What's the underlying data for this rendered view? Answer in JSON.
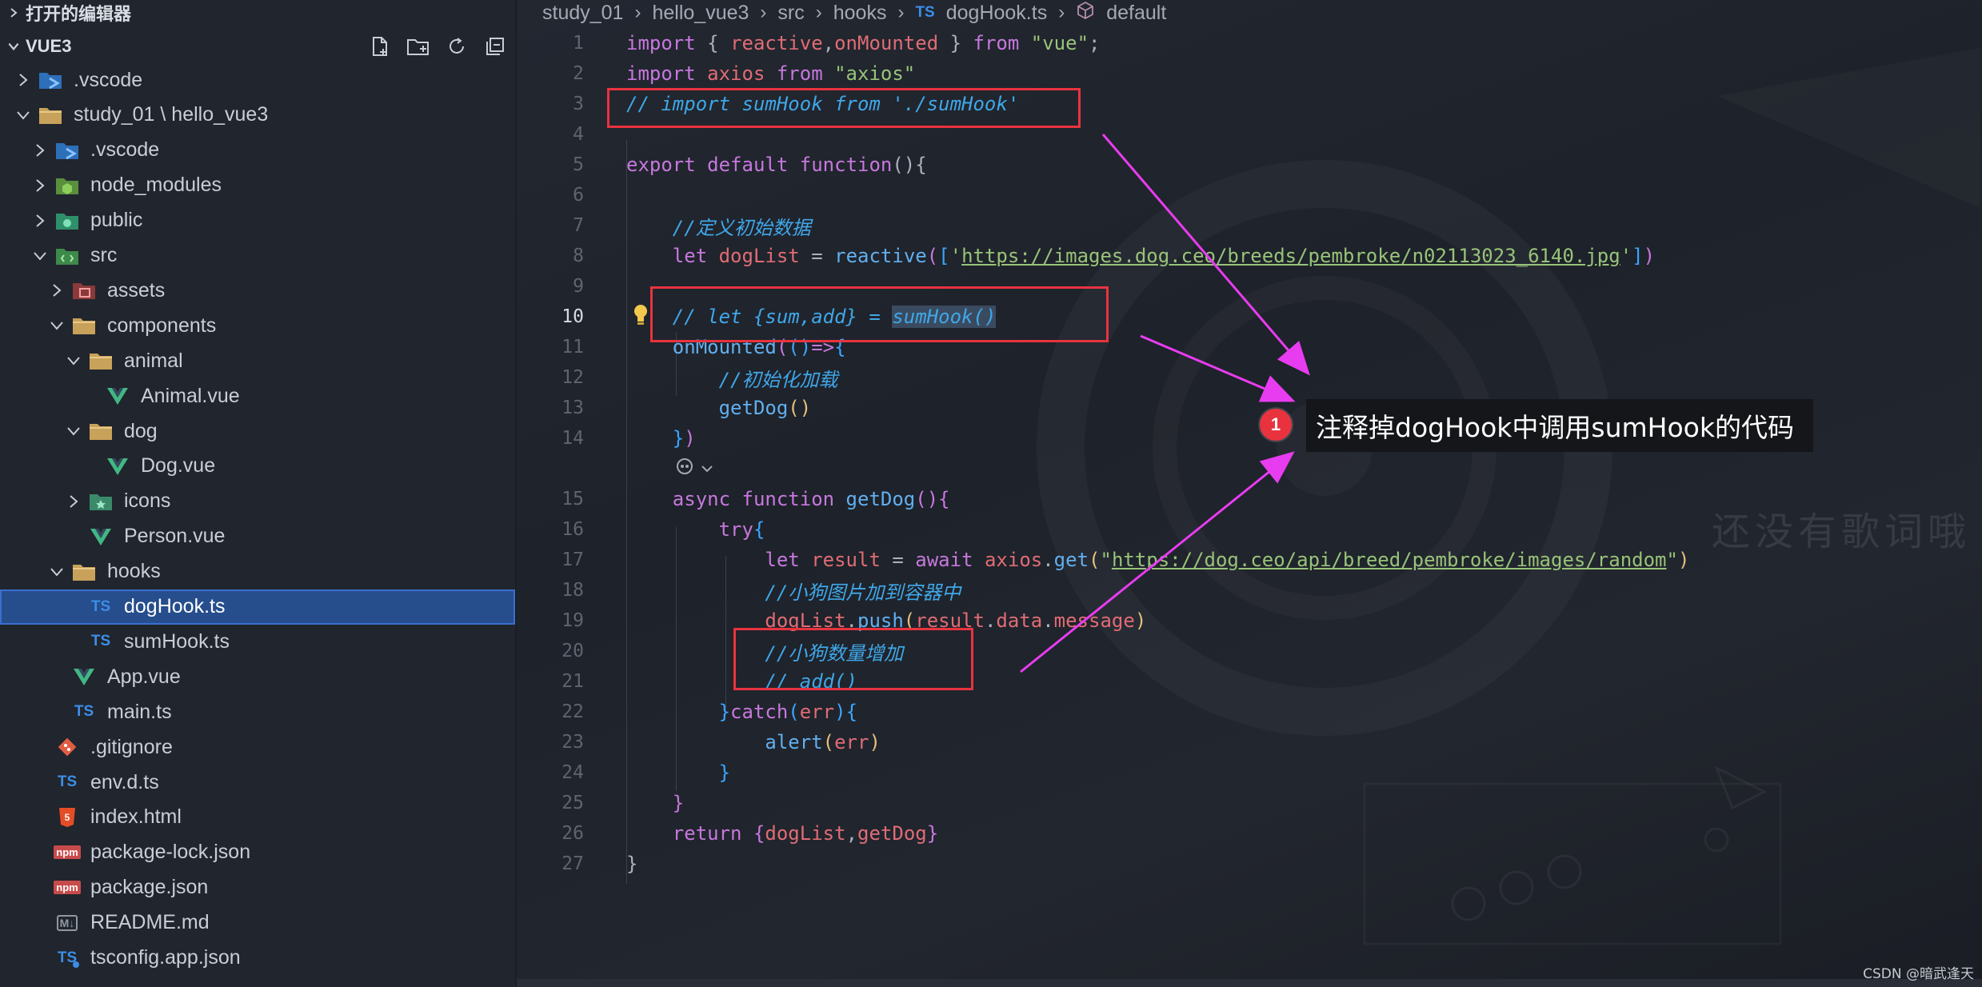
{
  "sidebar": {
    "open_editors_label": "打开的编辑器",
    "workspace_label": "VUE3",
    "tree": [
      {
        "label": ".vscode",
        "depth": 0,
        "chevron": "right",
        "icon": "vscode-folder-icon"
      },
      {
        "label": "study_01 \\ hello_vue3",
        "depth": 0,
        "chevron": "down",
        "icon": "folder-open-icon"
      },
      {
        "label": ".vscode",
        "depth": 1,
        "chevron": "right",
        "icon": "vscode-folder-icon"
      },
      {
        "label": "node_modules",
        "depth": 1,
        "chevron": "right",
        "icon": "node-folder-icon"
      },
      {
        "label": "public",
        "depth": 1,
        "chevron": "right",
        "icon": "public-folder-icon"
      },
      {
        "label": "src",
        "depth": 1,
        "chevron": "down",
        "icon": "src-folder-icon"
      },
      {
        "label": "assets",
        "depth": 2,
        "chevron": "right",
        "icon": "assets-folder-icon"
      },
      {
        "label": "components",
        "depth": 2,
        "chevron": "down",
        "icon": "folder-open-icon"
      },
      {
        "label": "animal",
        "depth": 3,
        "chevron": "down",
        "icon": "folder-open-icon"
      },
      {
        "label": "Animal.vue",
        "depth": 4,
        "chevron": "none",
        "icon": "vue-file-icon"
      },
      {
        "label": "dog",
        "depth": 3,
        "chevron": "down",
        "icon": "folder-open-icon"
      },
      {
        "label": "Dog.vue",
        "depth": 4,
        "chevron": "none",
        "icon": "vue-file-icon"
      },
      {
        "label": "icons",
        "depth": 3,
        "chevron": "right",
        "icon": "icons-folder-icon"
      },
      {
        "label": "Person.vue",
        "depth": 3,
        "chevron": "none",
        "icon": "vue-file-icon"
      },
      {
        "label": "hooks",
        "depth": 2,
        "chevron": "down",
        "icon": "folder-open-icon"
      },
      {
        "label": "dogHook.ts",
        "depth": 3,
        "chevron": "none",
        "icon": "ts-file-icon",
        "selected": true
      },
      {
        "label": "sumHook.ts",
        "depth": 3,
        "chevron": "none",
        "icon": "ts-file-icon"
      },
      {
        "label": "App.vue",
        "depth": 2,
        "chevron": "none",
        "icon": "vue-file-icon"
      },
      {
        "label": "main.ts",
        "depth": 2,
        "chevron": "none",
        "icon": "ts-file-icon"
      },
      {
        "label": ".gitignore",
        "depth": 1,
        "chevron": "none",
        "icon": "git-file-icon"
      },
      {
        "label": "env.d.ts",
        "depth": 1,
        "chevron": "none",
        "icon": "ts-file-icon"
      },
      {
        "label": "index.html",
        "depth": 1,
        "chevron": "none",
        "icon": "html-file-icon"
      },
      {
        "label": "package-lock.json",
        "depth": 1,
        "chevron": "none",
        "icon": "npm-file-icon"
      },
      {
        "label": "package.json",
        "depth": 1,
        "chevron": "none",
        "icon": "npm-file-icon"
      },
      {
        "label": "README.md",
        "depth": 1,
        "chevron": "none",
        "icon": "markdown-file-icon"
      },
      {
        "label": "tsconfig.app.json",
        "depth": 1,
        "chevron": "none",
        "icon": "tsconfig-file-icon"
      }
    ]
  },
  "breadcrumb": {
    "items": [
      "study_01",
      "hello_vue3",
      "src",
      "hooks",
      "dogHook.ts",
      "default"
    ],
    "ts_badge": "TS"
  },
  "badges": {
    "ts": "TS",
    "md": "M↓",
    "npm": "npm"
  },
  "editor": {
    "active_line": 10,
    "lines": [
      {
        "n": "1",
        "tokens": [
          [
            "kw",
            "import"
          ],
          [
            "punc",
            " { "
          ],
          [
            "var",
            "reactive"
          ],
          [
            "punc",
            ","
          ],
          [
            "var",
            "onMounted"
          ],
          [
            "punc",
            " } "
          ],
          [
            "kw",
            "from"
          ],
          [
            "punc",
            " "
          ],
          [
            "str",
            "\"vue\""
          ],
          [
            "punc",
            ";"
          ]
        ]
      },
      {
        "n": "2",
        "tokens": [
          [
            "kw",
            "import"
          ],
          [
            "punc",
            " "
          ],
          [
            "var",
            "axios"
          ],
          [
            "punc",
            " "
          ],
          [
            "kw",
            "from"
          ],
          [
            "punc",
            " "
          ],
          [
            "str",
            "\"axios\""
          ]
        ]
      },
      {
        "n": "3",
        "tokens": [
          [
            "cm",
            "// import sumHook from './sumHook'"
          ]
        ]
      },
      {
        "n": "4",
        "tokens": []
      },
      {
        "n": "5",
        "tokens": [
          [
            "kw",
            "export"
          ],
          [
            "punc",
            " "
          ],
          [
            "kw",
            "default"
          ],
          [
            "punc",
            " "
          ],
          [
            "kw",
            "function"
          ],
          [
            "punc",
            "(){"
          ]
        ]
      },
      {
        "n": "6",
        "tokens": []
      },
      {
        "n": "7",
        "tokens": [
          [
            "punc",
            "    "
          ],
          [
            "cm",
            "//定义初始数据"
          ]
        ]
      },
      {
        "n": "8",
        "tokens": [
          [
            "punc",
            "    "
          ],
          [
            "kw",
            "let"
          ],
          [
            "punc",
            " "
          ],
          [
            "var",
            "dogList"
          ],
          [
            "punc",
            " = "
          ],
          [
            "fn",
            "reactive"
          ],
          [
            "brk1",
            "("
          ],
          [
            "brk2",
            "["
          ],
          [
            "str",
            "'"
          ],
          [
            "url",
            "https://images.dog.ceo/breeds/pembroke/n02113023_6140.jpg"
          ],
          [
            "str",
            "'"
          ],
          [
            "brk2",
            "]"
          ],
          [
            "brk1",
            ")"
          ]
        ]
      },
      {
        "n": "9",
        "tokens": []
      },
      {
        "n": "10",
        "tokens": [
          [
            "punc",
            "    "
          ],
          [
            "cm",
            "// let {sum,add} = "
          ],
          [
            "cmhl",
            "sumHook()"
          ]
        ]
      },
      {
        "n": "11",
        "tokens": [
          [
            "punc",
            "    "
          ],
          [
            "fn",
            "onMounted"
          ],
          [
            "brk1",
            "("
          ],
          [
            "brk2",
            "()"
          ],
          [
            "kw",
            "=>"
          ],
          [
            "brk2",
            "{"
          ]
        ]
      },
      {
        "n": "12",
        "tokens": [
          [
            "punc",
            "        "
          ],
          [
            "cm",
            "//初始化加载"
          ]
        ]
      },
      {
        "n": "13",
        "tokens": [
          [
            "punc",
            "        "
          ],
          [
            "fn",
            "getDog"
          ],
          [
            "brk3",
            "()"
          ]
        ]
      },
      {
        "n": "14",
        "tokens": [
          [
            "punc",
            "    "
          ],
          [
            "brk2",
            "}"
          ],
          [
            "brk1",
            ")"
          ]
        ]
      },
      {
        "n": "",
        "tokens": [],
        "codelens": true
      },
      {
        "n": "15",
        "tokens": [
          [
            "punc",
            "    "
          ],
          [
            "kw",
            "async"
          ],
          [
            "punc",
            " "
          ],
          [
            "kw",
            "function"
          ],
          [
            "punc",
            " "
          ],
          [
            "fn",
            "getDog"
          ],
          [
            "brk1",
            "()"
          ],
          [
            "brk1",
            "{"
          ]
        ]
      },
      {
        "n": "16",
        "tokens": [
          [
            "punc",
            "        "
          ],
          [
            "kw",
            "try"
          ],
          [
            "brk2",
            "{"
          ]
        ]
      },
      {
        "n": "17",
        "tokens": [
          [
            "punc",
            "            "
          ],
          [
            "kw",
            "let"
          ],
          [
            "punc",
            " "
          ],
          [
            "var",
            "result"
          ],
          [
            "punc",
            " = "
          ],
          [
            "kw",
            "await"
          ],
          [
            "punc",
            " "
          ],
          [
            "var",
            "axios"
          ],
          [
            "punc",
            "."
          ],
          [
            "fn",
            "get"
          ],
          [
            "brk3",
            "("
          ],
          [
            "str",
            "\""
          ],
          [
            "url",
            "https://dog.ceo/api/breed/pembroke/images/random"
          ],
          [
            "str",
            "\""
          ],
          [
            "brk3",
            ")"
          ]
        ]
      },
      {
        "n": "18",
        "tokens": [
          [
            "punc",
            "            "
          ],
          [
            "cm",
            "//小狗图片加到容器中"
          ]
        ]
      },
      {
        "n": "19",
        "tokens": [
          [
            "punc",
            "            "
          ],
          [
            "var",
            "dogList"
          ],
          [
            "punc",
            "."
          ],
          [
            "fn",
            "push"
          ],
          [
            "brk3",
            "("
          ],
          [
            "var",
            "result"
          ],
          [
            "punc",
            "."
          ],
          [
            "var",
            "data"
          ],
          [
            "punc",
            "."
          ],
          [
            "var",
            "message"
          ],
          [
            "brk3",
            ")"
          ]
        ]
      },
      {
        "n": "20",
        "tokens": [
          [
            "punc",
            "            "
          ],
          [
            "cm",
            "//小狗数量增加"
          ]
        ]
      },
      {
        "n": "21",
        "tokens": [
          [
            "punc",
            "            "
          ],
          [
            "cm",
            "// add()"
          ]
        ]
      },
      {
        "n": "22",
        "tokens": [
          [
            "punc",
            "        "
          ],
          [
            "brk2",
            "}"
          ],
          [
            "kw",
            "catch"
          ],
          [
            "brk2",
            "("
          ],
          [
            "var",
            "err"
          ],
          [
            "brk2",
            ")"
          ],
          [
            "brk2",
            "{"
          ]
        ]
      },
      {
        "n": "23",
        "tokens": [
          [
            "punc",
            "            "
          ],
          [
            "fn",
            "alert"
          ],
          [
            "brk3",
            "("
          ],
          [
            "var",
            "err"
          ],
          [
            "brk3",
            ")"
          ]
        ]
      },
      {
        "n": "24",
        "tokens": [
          [
            "punc",
            "        "
          ],
          [
            "brk2",
            "}"
          ]
        ]
      },
      {
        "n": "25",
        "tokens": [
          [
            "punc",
            "    "
          ],
          [
            "brk1",
            "}"
          ]
        ]
      },
      {
        "n": "26",
        "tokens": [
          [
            "punc",
            "    "
          ],
          [
            "kw",
            "return"
          ],
          [
            "punc",
            " "
          ],
          [
            "brk1",
            "{"
          ],
          [
            "var",
            "dogList"
          ],
          [
            "punc",
            ","
          ],
          [
            "var",
            "getDog"
          ],
          [
            "brk1",
            "}"
          ]
        ]
      },
      {
        "n": "27",
        "tokens": [
          [
            "punc",
            "}"
          ]
        ]
      }
    ]
  },
  "annotation": {
    "number": "1",
    "text": "注释掉dogHook中调用sumHook的代码"
  },
  "watermark": "还没有歌词哦",
  "credit": "CSDN @暗武逢天",
  "colors": {
    "selection": "#264d8c",
    "annotation_red": "#e8333f",
    "arrow_magenta": "#e83cf0",
    "ts_blue": "#3b8ee8",
    "vue_green": "#41b883"
  }
}
